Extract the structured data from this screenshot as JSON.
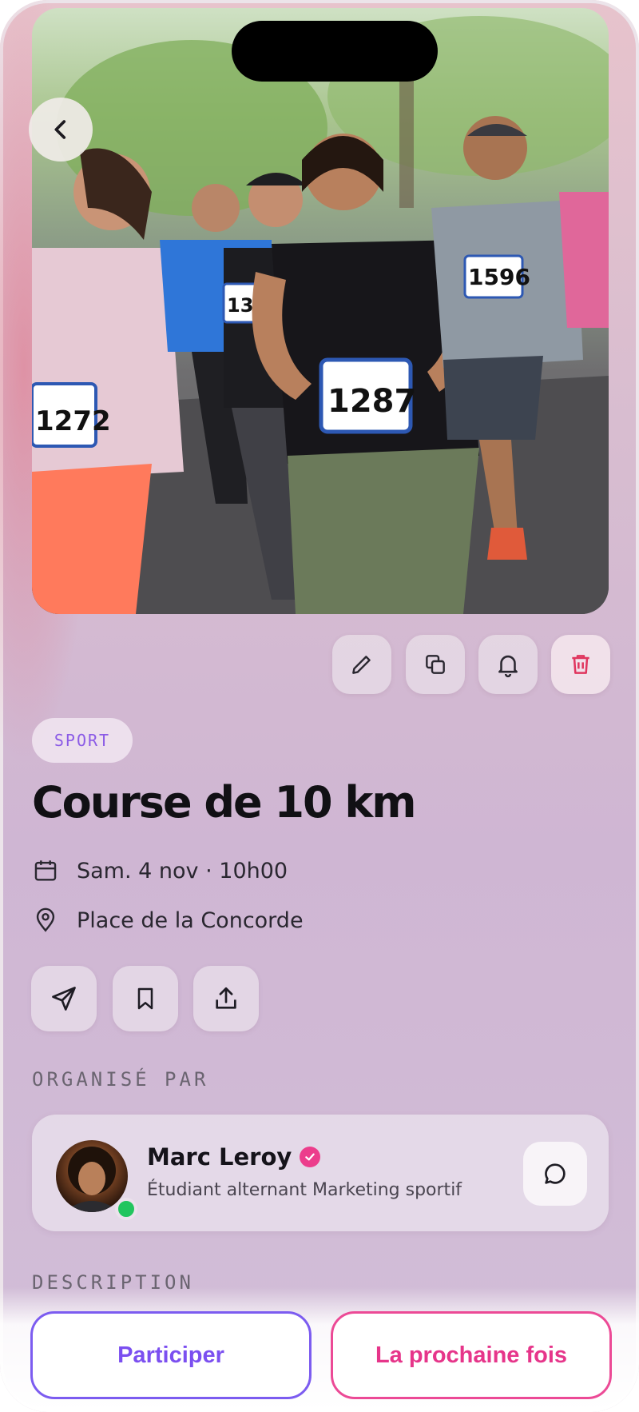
{
  "header": {
    "back_icon": "chevron-left-icon"
  },
  "toolbar": {
    "edit_icon": "pencil-icon",
    "duplicate_icon": "copy-icon",
    "reminder_icon": "bell-icon",
    "delete_icon": "trash-icon"
  },
  "event": {
    "category": "SPORT",
    "title": "Course de 10 km",
    "datetime": "Sam. 4 nov · 10h00",
    "location": "Place de la Concorde",
    "bib_numbers": [
      "1272",
      "135",
      "1287",
      "1596"
    ]
  },
  "actions": {
    "send_icon": "send-icon",
    "bookmark_icon": "bookmark-icon",
    "share_icon": "share-icon"
  },
  "organizer": {
    "section_label": "ORGANISÉ PAR",
    "name": "Marc Leroy",
    "role": "Étudiant alternant Marketing sportif",
    "status": "online"
  },
  "description": {
    "section_label": "DESCRIPTION"
  },
  "cta": {
    "participate_label": "Participer",
    "next_time_label": "La prochaine fois"
  },
  "colors": {
    "accent_purple": "#7b4ff0",
    "accent_pink": "#e6358a",
    "delete_red": "#e0365f",
    "online_green": "#22c55e"
  }
}
